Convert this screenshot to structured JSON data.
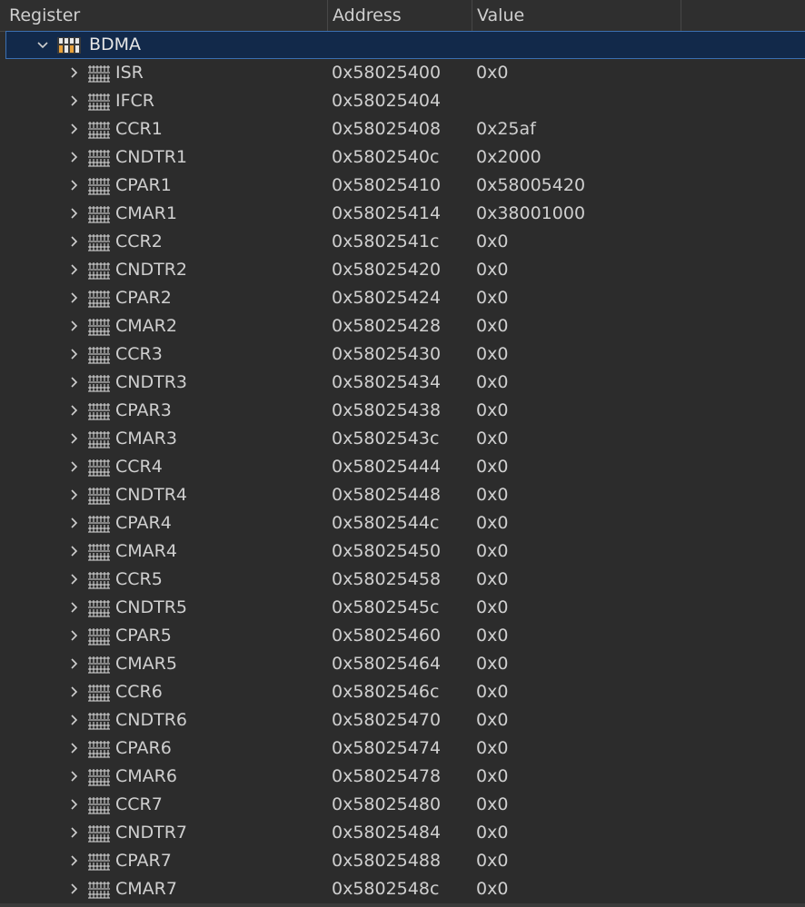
{
  "columns": {
    "register": "Register",
    "address": "Address",
    "value": "Value"
  },
  "root": {
    "name": "BDMA",
    "icon": "peripheral-icon",
    "expanded": true
  },
  "registers": [
    {
      "name": "ISR",
      "address": "0x58025400",
      "value": "0x0"
    },
    {
      "name": "IFCR",
      "address": "0x58025404",
      "value": ""
    },
    {
      "name": "CCR1",
      "address": "0x58025408",
      "value": "0x25af"
    },
    {
      "name": "CNDTR1",
      "address": "0x5802540c",
      "value": "0x2000"
    },
    {
      "name": "CPAR1",
      "address": "0x58025410",
      "value": "0x58005420"
    },
    {
      "name": "CMAR1",
      "address": "0x58025414",
      "value": "0x38001000"
    },
    {
      "name": "CCR2",
      "address": "0x5802541c",
      "value": "0x0"
    },
    {
      "name": "CNDTR2",
      "address": "0x58025420",
      "value": "0x0"
    },
    {
      "name": "CPAR2",
      "address": "0x58025424",
      "value": "0x0"
    },
    {
      "name": "CMAR2",
      "address": "0x58025428",
      "value": "0x0"
    },
    {
      "name": "CCR3",
      "address": "0x58025430",
      "value": "0x0"
    },
    {
      "name": "CNDTR3",
      "address": "0x58025434",
      "value": "0x0"
    },
    {
      "name": "CPAR3",
      "address": "0x58025438",
      "value": "0x0"
    },
    {
      "name": "CMAR3",
      "address": "0x5802543c",
      "value": "0x0"
    },
    {
      "name": "CCR4",
      "address": "0x58025444",
      "value": "0x0"
    },
    {
      "name": "CNDTR4",
      "address": "0x58025448",
      "value": "0x0"
    },
    {
      "name": "CPAR4",
      "address": "0x5802544c",
      "value": "0x0"
    },
    {
      "name": "CMAR4",
      "address": "0x58025450",
      "value": "0x0"
    },
    {
      "name": "CCR5",
      "address": "0x58025458",
      "value": "0x0"
    },
    {
      "name": "CNDTR5",
      "address": "0x5802545c",
      "value": "0x0"
    },
    {
      "name": "CPAR5",
      "address": "0x58025460",
      "value": "0x0"
    },
    {
      "name": "CMAR5",
      "address": "0x58025464",
      "value": "0x0"
    },
    {
      "name": "CCR6",
      "address": "0x5802546c",
      "value": "0x0"
    },
    {
      "name": "CNDTR6",
      "address": "0x58025470",
      "value": "0x0"
    },
    {
      "name": "CPAR6",
      "address": "0x58025474",
      "value": "0x0"
    },
    {
      "name": "CMAR6",
      "address": "0x58025478",
      "value": "0x0"
    },
    {
      "name": "CCR7",
      "address": "0x58025480",
      "value": "0x0"
    },
    {
      "name": "CNDTR7",
      "address": "0x58025484",
      "value": "0x0"
    },
    {
      "name": "CPAR7",
      "address": "0x58025488",
      "value": "0x0"
    },
    {
      "name": "CMAR7",
      "address": "0x5802548c",
      "value": "0x0"
    }
  ],
  "colors": {
    "background": "#2c2c2c",
    "text": "#cfcfcf",
    "selection": "#12294a",
    "selection_border": "#3b6fb0"
  }
}
